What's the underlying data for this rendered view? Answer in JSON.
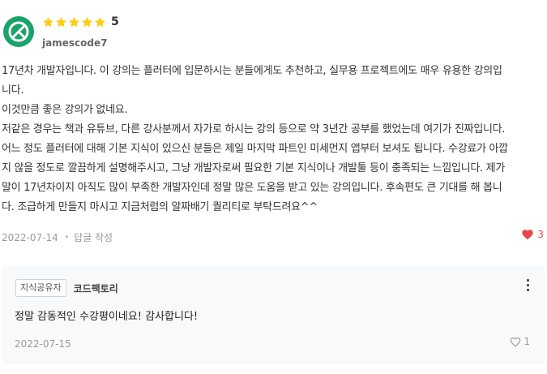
{
  "review": {
    "avatar_icon": "leaf-avatar-icon",
    "rating": "5",
    "star_count": 5,
    "username": "jamescode7",
    "lines": [
      "17년차 개발자입니다. 이 강의는 플러터에 입문하시는 분들에게도 추천하고, 실무용 프로젝트에도 매우 유용한 강의입",
      "니다.",
      "이것만큼 좋은 강의가 없네요.",
      "저같은 경우는 책과 유튜브, 다른 강사분께서 자가로 하시는 강의 등으로 약 3년간 공부를 했었는데 여기가 진짜입니다.",
      "어느 정도 플러터에 대해 기본 지식이 있으신 분들은 제일 마지막 파트인 미세먼지 앱부터 보셔도 됩니다. 수강료가 아깝",
      "지 않을 정도로 깔끔하게 설명해주시고, 그냥 개발자로써 필요한 기본 지식이나 개발툴 등이 충족되는 느낌입니다. 제가",
      "말이 17년차이지 아직도 많이 부족한 개발자인데 정말 많은 도움을 받고 있는 강의입니다. 후속편도 큰 기대를 해 봅니",
      "다. 조급하게 만들지 마시고 지금처럼의 알짜배기 퀄리티로 부탁드려요^^"
    ],
    "date": "2022-07-14",
    "reply_label": "답글 작성",
    "likes": "3"
  },
  "answer": {
    "badge": "지식공유자",
    "author": "코드팩토리",
    "text": "정말 감동적인 수강평이네요! 감사합니다!",
    "date": "2022-07-15",
    "likes": "1"
  },
  "colors": {
    "star": "#fdcc11",
    "avatar": "#1aa36b",
    "heart": "#e5484d"
  }
}
